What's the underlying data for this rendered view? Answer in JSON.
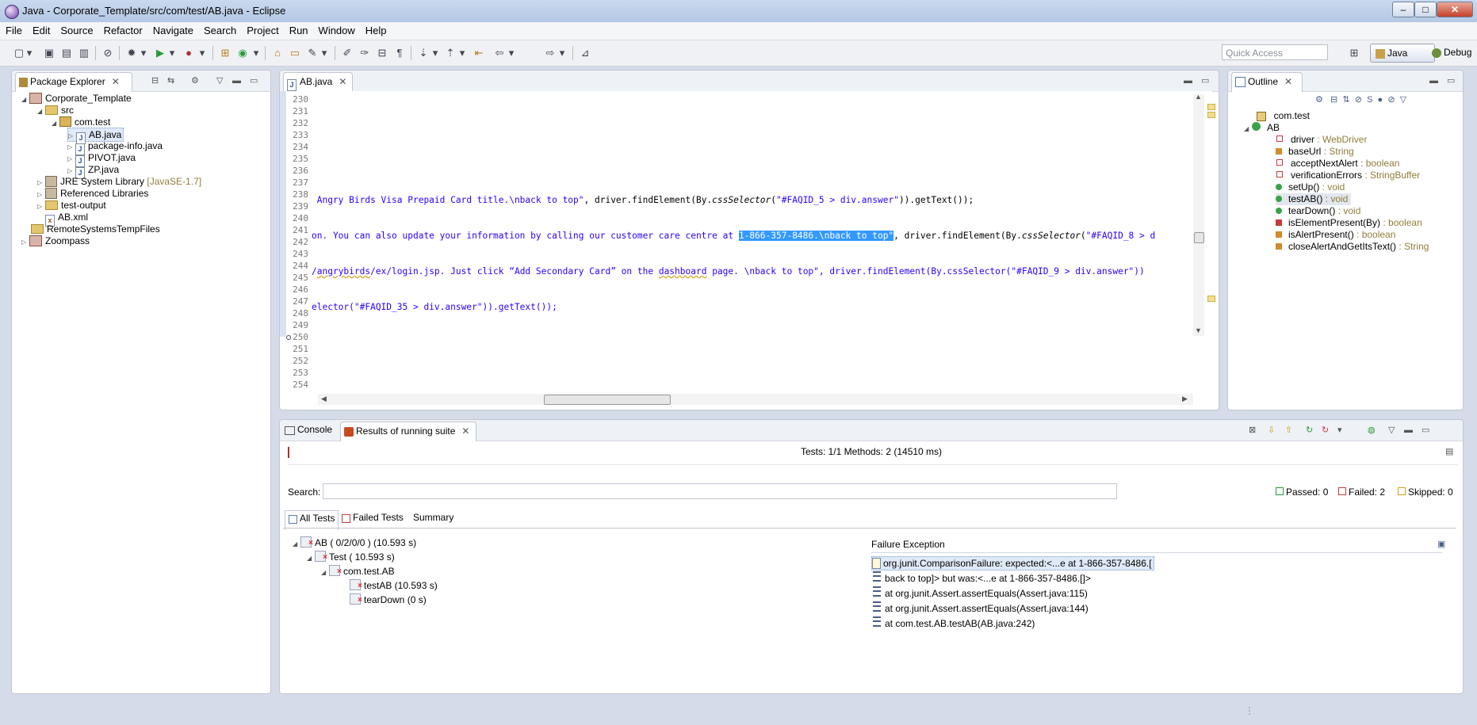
{
  "window": {
    "title": "Java - Corporate_Template/src/com/test/AB.java - Eclipse",
    "min": "–",
    "max": "□",
    "close": "✕"
  },
  "menu": [
    "File",
    "Edit",
    "Source",
    "Refactor",
    "Navigate",
    "Search",
    "Project",
    "Run",
    "Window",
    "Help"
  ],
  "toolbar": {
    "quick_access_placeholder": "Quick Access",
    "perspective_java": "Java",
    "perspective_debug": "Debug"
  },
  "package_explorer": {
    "tab": "Package Explorer",
    "tree": {
      "project": "Corporate_Template",
      "src": "src",
      "package": "com.test",
      "files": [
        "AB.java",
        "package-info.java",
        "PIVOT.java",
        "ZP.java"
      ],
      "jre": "JRE System Library",
      "jre_deco": "[JavaSE-1.7]",
      "ref_libs": "Referenced Libraries",
      "test_output": "test-output",
      "ab_xml": "AB.xml",
      "remote": "RemoteSystemsTempFiles",
      "zoompass": "Zoompass"
    }
  },
  "editor": {
    "tab": "AB.java",
    "line_numbers": [
      "230",
      "231",
      "232",
      "233",
      "234",
      "235",
      "236",
      "237",
      "238",
      "239",
      "240",
      "241",
      "242",
      "243",
      "244",
      "245",
      "246",
      "247",
      "248",
      "249",
      "250",
      "251",
      "252",
      "253",
      "254"
    ],
    "line239": {
      "a": " Angry Birds Visa Prepaid Card title.\\nback to top\"",
      "b": ", driver.findElement(By.",
      "c": "cssSelector",
      "d": "(",
      "e": "\"#FAQID_5 > div.answer\"",
      "f": ")).getText());"
    },
    "line242": {
      "a": "on. You can also update your information by calling our customer care centre at ",
      "sel": "1-866-357-8486.\\nback to top\"",
      "b": ", driver.findElement(By.",
      "c": "cssSelector",
      "d": "(",
      "e": "\"#FAQID_8 > d"
    },
    "line245": {
      "a": "/",
      "b": "angrybirds",
      "c": "/ex/login.jsp. Just click “Add Secondary Card” on the ",
      "d": "dashboard",
      "e": " page. \\nback to top\", driver.findElement(By.cssSelector(\"#FAQID_9 > div.answer\"))"
    },
    "line248": {
      "a": "elector(\"#FAQID_35 > div.answer\")).getText());"
    }
  },
  "outline": {
    "tab": "Outline",
    "package": "com.test",
    "class": "AB",
    "members": [
      {
        "name": "driver",
        "type": " : WebDriver"
      },
      {
        "name": "baseUrl",
        "type": " : String"
      },
      {
        "name": "acceptNextAlert",
        "type": " : boolean"
      },
      {
        "name": "verificationErrors",
        "type": " : StringBuffer"
      },
      {
        "name": "setUp()",
        "type": " : void"
      },
      {
        "name": "testAB()",
        "type": " : void"
      },
      {
        "name": "tearDown()",
        "type": " : void"
      },
      {
        "name": "isElementPresent(By)",
        "type": " : boolean"
      },
      {
        "name": "isAlertPresent()",
        "type": " : boolean"
      },
      {
        "name": "closeAlertAndGetItsText()",
        "type": " : String"
      }
    ]
  },
  "bottom": {
    "tab_console": "Console",
    "tab_results": "Results of running suite",
    "tests_summary": "Tests: 1/1  Methods: 2 (14510 ms)",
    "search_label": "Search:",
    "passed": "Passed: 0",
    "failed": "Failed: 2",
    "skipped": "Skipped: 0",
    "subtabs": [
      "All Tests",
      "Failed Tests",
      "Summary"
    ],
    "tree": [
      "AB ( 0/2/0/0 ) (10.593 s)",
      "Test ( 10.593 s)",
      "com.test.AB",
      "testAB  (10.593 s)",
      "tearDown  (0 s)"
    ],
    "failure_title": "Failure Exception",
    "failure_lines": [
      "org.junit.ComparisonFailure: expected:<...e at 1-866-357-8486.[",
      "back to top]> but was:<...e at 1-866-357-8486.[]>",
      "at org.junit.Assert.assertEquals(Assert.java:115)",
      "at org.junit.Assert.assertEquals(Assert.java:144)",
      "at com.test.AB.testAB(AB.java:242)"
    ]
  }
}
